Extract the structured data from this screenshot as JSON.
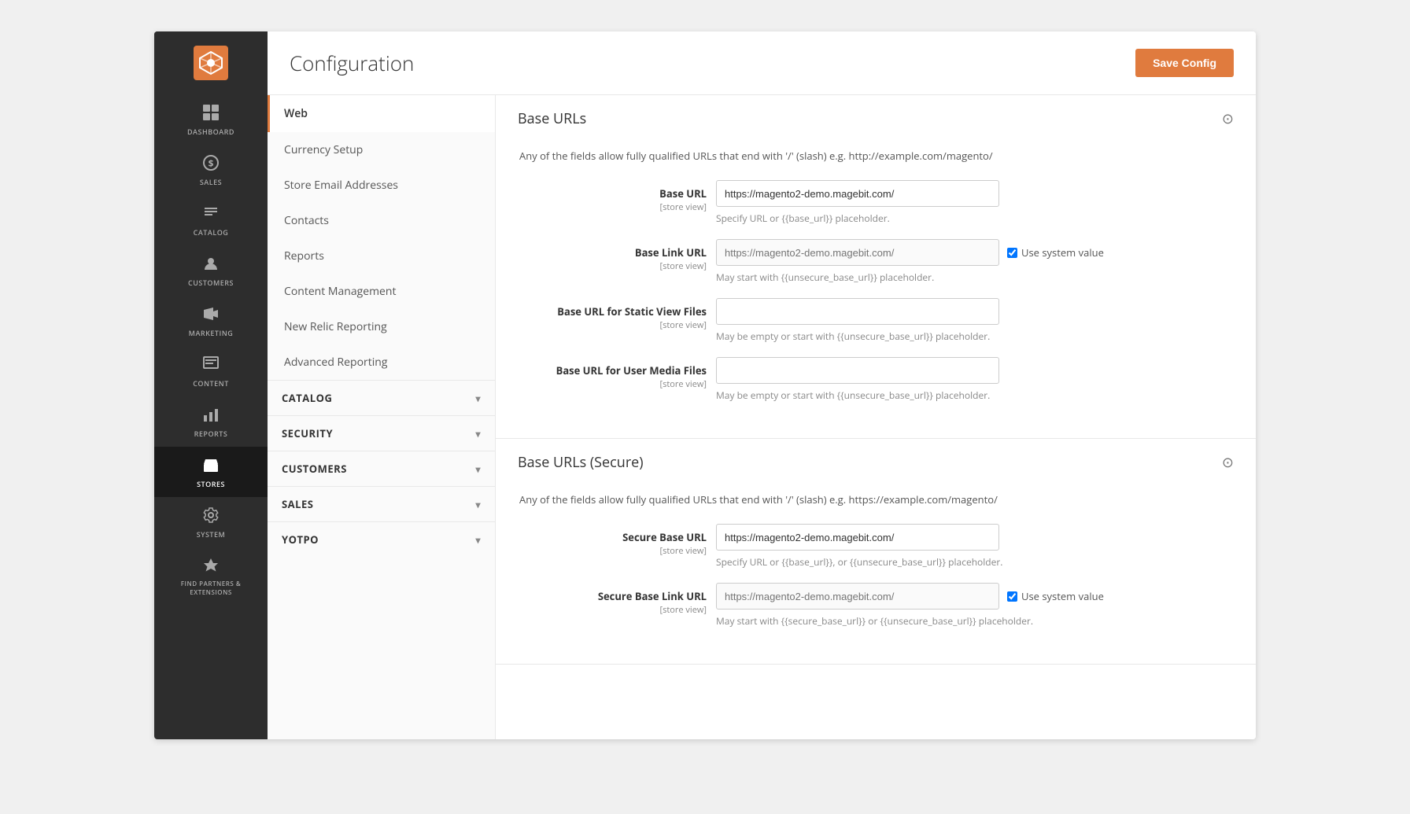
{
  "page": {
    "title": "Configuration",
    "save_button": "Save Config"
  },
  "sidebar": {
    "items": [
      {
        "id": "dashboard",
        "label": "DASHBOARD",
        "icon": "⊞"
      },
      {
        "id": "sales",
        "label": "SALES",
        "icon": "＄"
      },
      {
        "id": "catalog",
        "label": "CATALOG",
        "icon": "⬡"
      },
      {
        "id": "customers",
        "label": "CUSTOMERS",
        "icon": "👤"
      },
      {
        "id": "marketing",
        "label": "MARKETING",
        "icon": "📢"
      },
      {
        "id": "content",
        "label": "CONTENT",
        "icon": "▤"
      },
      {
        "id": "reports",
        "label": "REPORTS",
        "icon": "📊"
      },
      {
        "id": "stores",
        "label": "STORES",
        "icon": "🏪",
        "active": true
      },
      {
        "id": "system",
        "label": "SYSTEM",
        "icon": "⚙"
      },
      {
        "id": "extensions",
        "label": "FIND PARTNERS & EXTENSIONS",
        "icon": "⬡"
      }
    ]
  },
  "left_panel": {
    "active_item": "Web",
    "items": [
      {
        "label": "Currency Setup"
      },
      {
        "label": "Store Email Addresses"
      },
      {
        "label": "Contacts"
      },
      {
        "label": "Reports"
      },
      {
        "label": "Content Management"
      },
      {
        "label": "New Relic Reporting"
      },
      {
        "label": "Advanced Reporting"
      }
    ],
    "sections": [
      {
        "label": "CATALOG",
        "id": "catalog"
      },
      {
        "label": "SECURITY",
        "id": "security"
      },
      {
        "label": "CUSTOMERS",
        "id": "customers"
      },
      {
        "label": "SALES",
        "id": "sales"
      },
      {
        "label": "YOTPO",
        "id": "yotpo"
      }
    ]
  },
  "config_sections": [
    {
      "id": "base-urls",
      "title": "Base URLs",
      "description": "Any of the fields allow fully qualified URLs that end with '/' (slash) e.g. http://example.com/magento/",
      "fields": [
        {
          "label": "Base URL",
          "sub": "[store view]",
          "value": "https://magento2-demo.magebit.com/",
          "hint": "Specify URL or {{base_url}} placeholder.",
          "use_system_value": false,
          "disabled": false
        },
        {
          "label": "Base Link URL",
          "sub": "[store view]",
          "value": "https://magento2-demo.magebit.com/",
          "hint": "May start with {{unsecure_base_url}} placeholder.",
          "use_system_value": true,
          "disabled": true
        },
        {
          "label": "Base URL for Static View Files",
          "sub": "[store view]",
          "value": "",
          "hint": "May be empty or start with {{unsecure_base_url}} placeholder.",
          "use_system_value": false,
          "disabled": false
        },
        {
          "label": "Base URL for User Media Files",
          "sub": "[store view]",
          "value": "",
          "hint": "May be empty or start with {{unsecure_base_url}} placeholder.",
          "use_system_value": false,
          "disabled": false
        }
      ]
    },
    {
      "id": "base-urls-secure",
      "title": "Base URLs (Secure)",
      "description": "Any of the fields allow fully qualified URLs that end with '/' (slash) e.g. https://example.com/magento/",
      "fields": [
        {
          "label": "Secure Base URL",
          "sub": "[store view]",
          "value": "https://magento2-demo.magebit.com/",
          "hint": "Specify URL or {{base_url}}, or {{unsecure_base_url}} placeholder.",
          "use_system_value": false,
          "disabled": false
        },
        {
          "label": "Secure Base Link URL",
          "sub": "[store view]",
          "value": "https://magento2-demo.magebit.com/",
          "hint": "May start with {{secure_base_url}} or {{unsecure_base_url}} placeholder.",
          "use_system_value": true,
          "disabled": true
        }
      ]
    }
  ],
  "use_system_value_label": "Use system value"
}
